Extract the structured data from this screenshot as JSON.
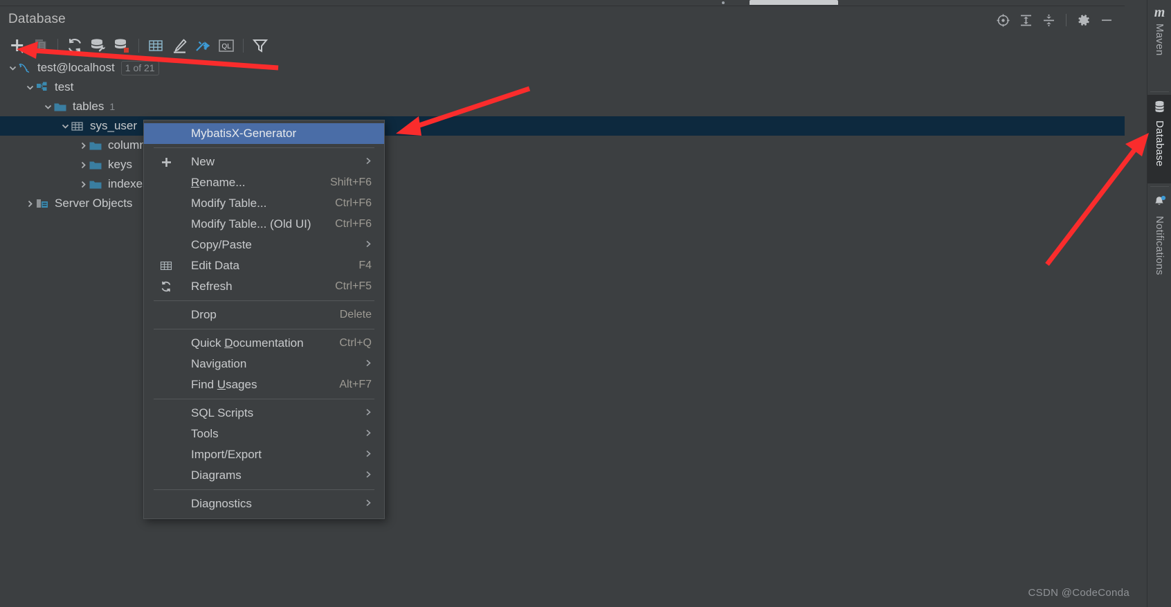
{
  "window": {
    "title": "Database",
    "watermark": "CSDN @CodeConda"
  },
  "header_actions": [
    {
      "name": "scroll-from-source-icon",
      "label": "Scroll from Source"
    },
    {
      "name": "expand-all-icon",
      "label": "Expand All"
    },
    {
      "name": "collapse-all-icon",
      "label": "Collapse All"
    },
    {
      "name": "gear-icon",
      "label": "Options"
    },
    {
      "name": "minimize-icon",
      "label": "Hide"
    }
  ],
  "toolbar": [
    {
      "name": "add-icon",
      "label": "New"
    },
    {
      "name": "duplicate-icon",
      "label": "Duplicate"
    },
    {
      "name": "refresh-icon",
      "label": "Refresh"
    },
    {
      "name": "data-source-properties-icon",
      "label": "Data Source Properties"
    },
    {
      "name": "database-color-icon",
      "label": "Database Color"
    },
    {
      "name": "table-editor-icon",
      "label": "Open Table Editor"
    },
    {
      "name": "modify-icon",
      "label": "Modify"
    },
    {
      "name": "jump-to-console-icon",
      "label": "Jump to Console"
    },
    {
      "name": "query-console-icon",
      "label": "QL"
    },
    {
      "name": "filter-icon",
      "label": "Filter"
    }
  ],
  "tree": [
    {
      "name": "tree-node-datasource",
      "label": "test@localhost",
      "badge": "1 of 21",
      "icon": "mysql-icon",
      "indent": 0,
      "expanded": true,
      "selected": false
    },
    {
      "name": "tree-node-schema",
      "label": "test",
      "icon": "schema-icon",
      "indent": 1,
      "expanded": true,
      "selected": false
    },
    {
      "name": "tree-node-tables-folder",
      "label": "tables",
      "count": "1",
      "icon": "folder-icon",
      "indent": 2,
      "expanded": true,
      "selected": false
    },
    {
      "name": "tree-node-table-sys-user",
      "label": "sys_user",
      "icon": "table-icon",
      "indent": 3,
      "expanded": true,
      "selected": true
    },
    {
      "name": "tree-node-columns-folder",
      "label": "columns",
      "icon": "folder-icon",
      "indent": 4,
      "expanded": false,
      "selected": false
    },
    {
      "name": "tree-node-keys-folder",
      "label": "keys",
      "icon": "folder-icon",
      "indent": 4,
      "expanded": false,
      "selected": false
    },
    {
      "name": "tree-node-indexes-folder",
      "label": "indexes",
      "icon": "folder-icon",
      "indent": 4,
      "expanded": false,
      "selected": false
    },
    {
      "name": "tree-node-server-objects",
      "label": "Server Objects",
      "icon": "server-objects-icon",
      "indent": 1,
      "expanded": false,
      "selected": false
    }
  ],
  "context_menu": {
    "items": [
      {
        "name": "menu-item-mybatisx-generator",
        "label": "MybatisX-Generator",
        "accel": "",
        "icon": "",
        "arrow": false,
        "highlighted": true
      },
      {
        "name": "menu-separator",
        "type": "separator"
      },
      {
        "name": "menu-item-new",
        "label": "New",
        "accel": "",
        "icon": "plus-icon",
        "arrow": true
      },
      {
        "name": "menu-item-rename",
        "label": "Rename...",
        "accel": "Shift+F6",
        "icon": "",
        "arrow": false,
        "mnemonic": "R"
      },
      {
        "name": "menu-item-modify-table",
        "label": "Modify Table...",
        "accel": "Ctrl+F6",
        "icon": "",
        "arrow": false
      },
      {
        "name": "menu-item-modify-table-old-ui",
        "label": "Modify Table... (Old UI)",
        "accel": "Ctrl+F6",
        "icon": "",
        "arrow": false
      },
      {
        "name": "menu-item-copy-paste",
        "label": "Copy/Paste",
        "accel": "",
        "icon": "",
        "arrow": true
      },
      {
        "name": "menu-item-edit-data",
        "label": "Edit Data",
        "accel": "F4",
        "icon": "table-icon",
        "arrow": false
      },
      {
        "name": "menu-item-refresh",
        "label": "Refresh",
        "accel": "Ctrl+F5",
        "icon": "refresh-icon",
        "arrow": false
      },
      {
        "name": "menu-separator",
        "type": "separator"
      },
      {
        "name": "menu-item-drop",
        "label": "Drop",
        "accel": "Delete",
        "icon": "",
        "arrow": false
      },
      {
        "name": "menu-separator",
        "type": "separator"
      },
      {
        "name": "menu-item-quick-documentation",
        "label": "Quick Documentation",
        "accel": "Ctrl+Q",
        "icon": "",
        "arrow": false,
        "mnemonic": "D"
      },
      {
        "name": "menu-item-navigation",
        "label": "Navigation",
        "accel": "",
        "icon": "",
        "arrow": true
      },
      {
        "name": "menu-item-find-usages",
        "label": "Find Usages",
        "accel": "Alt+F7",
        "icon": "",
        "arrow": false,
        "mnemonic": "U"
      },
      {
        "name": "menu-separator",
        "type": "separator"
      },
      {
        "name": "menu-item-sql-scripts",
        "label": "SQL Scripts",
        "accel": "",
        "icon": "",
        "arrow": true
      },
      {
        "name": "menu-item-tools",
        "label": "Tools",
        "accel": "",
        "icon": "",
        "arrow": true
      },
      {
        "name": "menu-item-import-export",
        "label": "Import/Export",
        "accel": "",
        "icon": "",
        "arrow": true
      },
      {
        "name": "menu-item-diagrams",
        "label": "Diagrams",
        "accel": "",
        "icon": "",
        "arrow": true
      },
      {
        "name": "menu-separator",
        "type": "separator"
      },
      {
        "name": "menu-item-diagnostics",
        "label": "Diagnostics",
        "accel": "",
        "icon": "",
        "arrow": true
      }
    ]
  },
  "sidebar_tabs": [
    {
      "name": "sidebar-tab-maven",
      "label": "Maven",
      "icon": "maven-m-icon",
      "active": false
    },
    {
      "name": "sidebar-tab-database",
      "label": "Database",
      "icon": "database-icon",
      "active": true
    },
    {
      "name": "sidebar-tab-notifications",
      "label": "Notifications",
      "icon": "bell-icon",
      "active": false,
      "has_badge": true
    }
  ],
  "colors": {
    "background": "#3c3f41",
    "selection": "#0d293e",
    "menu_highlight": "#4a6da7",
    "accent_blue": "#4a9fd0",
    "annotation_red": "#fa2c2c"
  }
}
